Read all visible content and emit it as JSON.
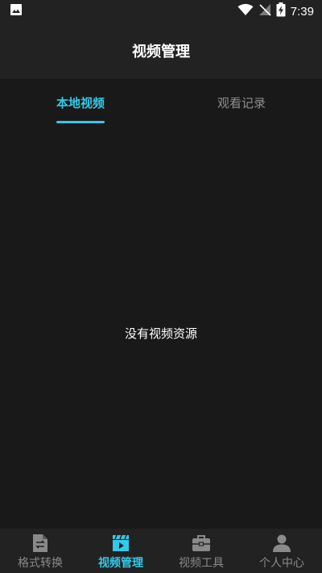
{
  "status_bar": {
    "time": "7:39"
  },
  "header": {
    "title": "视频管理"
  },
  "tabs": [
    {
      "label": "本地视频",
      "active": true
    },
    {
      "label": "观看记录",
      "active": false
    }
  ],
  "content": {
    "empty_message": "没有视频资源"
  },
  "bottom_nav": [
    {
      "label": "格式转换",
      "icon": "file-convert-icon",
      "active": false
    },
    {
      "label": "视频管理",
      "icon": "video-clapper-icon",
      "active": true
    },
    {
      "label": "视频工具",
      "icon": "toolbox-icon",
      "active": false
    },
    {
      "label": "个人中心",
      "icon": "person-icon",
      "active": false
    }
  ],
  "colors": {
    "accent": "#33c9e9",
    "background": "#191919",
    "bar": "#222222",
    "inactive": "#8a8a8a"
  }
}
